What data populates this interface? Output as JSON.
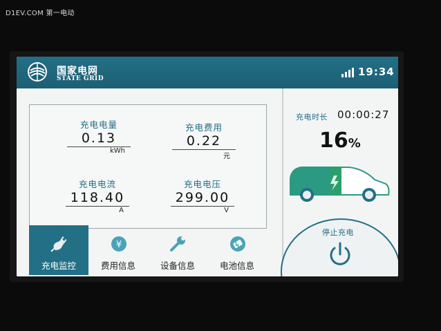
{
  "watermark": "D1EV.COM 第一电动",
  "header": {
    "brand_cn": "国家电网",
    "brand_en": "STATE GRID",
    "time": "19:34"
  },
  "metrics": {
    "energy": {
      "label": "充电电量",
      "value": "0.13",
      "unit": "kWh"
    },
    "cost": {
      "label": "充电费用",
      "value": "0.22",
      "unit": "元"
    },
    "current": {
      "label": "充电电流",
      "value": "118.40",
      "unit": "A"
    },
    "voltage": {
      "label": "充电电压",
      "value": "299.00",
      "unit": "V"
    }
  },
  "nav": [
    {
      "label": "充电监控",
      "icon": "plug-icon",
      "active": true
    },
    {
      "label": "费用信息",
      "icon": "yen-icon",
      "active": false
    },
    {
      "label": "设备信息",
      "icon": "wrench-icon",
      "active": false
    },
    {
      "label": "电池信息",
      "icon": "battery-icon",
      "active": false
    }
  ],
  "status": {
    "duration_label": "充电时长",
    "duration_value": "00:00:27",
    "soc_value": "16",
    "soc_unit": "%",
    "soc_fraction": 0.16
  },
  "stop": {
    "label": "停止充电"
  },
  "colors": {
    "accent": "#236f86",
    "car_body": "#2a9a82",
    "car_charged": "#2aa06a",
    "background": "#f3f5f5"
  }
}
